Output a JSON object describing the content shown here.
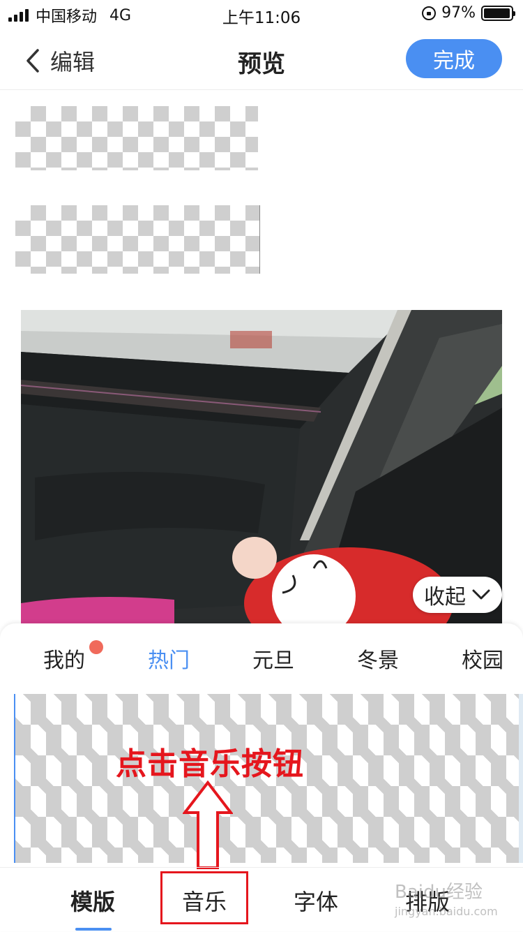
{
  "status_bar": {
    "carrier": "中国移动",
    "network": "4G",
    "time": "上午11:06",
    "battery": "97%",
    "battery_level": 0.97
  },
  "nav": {
    "back_label": "编辑",
    "title": "预览",
    "done_label": "完成"
  },
  "preview": {
    "collapse_label": "收起"
  },
  "panel": {
    "tabs": [
      {
        "label": "我的",
        "has_badge": true
      },
      {
        "label": "热门",
        "active": true
      },
      {
        "label": "元旦"
      },
      {
        "label": "冬景"
      },
      {
        "label": "校园"
      }
    ]
  },
  "annotation": {
    "text": "点击音乐按钮"
  },
  "bottom_nav": {
    "items": [
      {
        "label": "模版",
        "active": true
      },
      {
        "label": "音乐",
        "highlighted": true
      },
      {
        "label": "字体"
      },
      {
        "label": "排版"
      }
    ]
  },
  "watermark": {
    "line1": "Baidu经验",
    "line2": "jingyan.baidu.com"
  },
  "colors": {
    "accent": "#4a8ff2",
    "annotation_red": "#e5161d",
    "badge_red": "#f06a5b"
  }
}
